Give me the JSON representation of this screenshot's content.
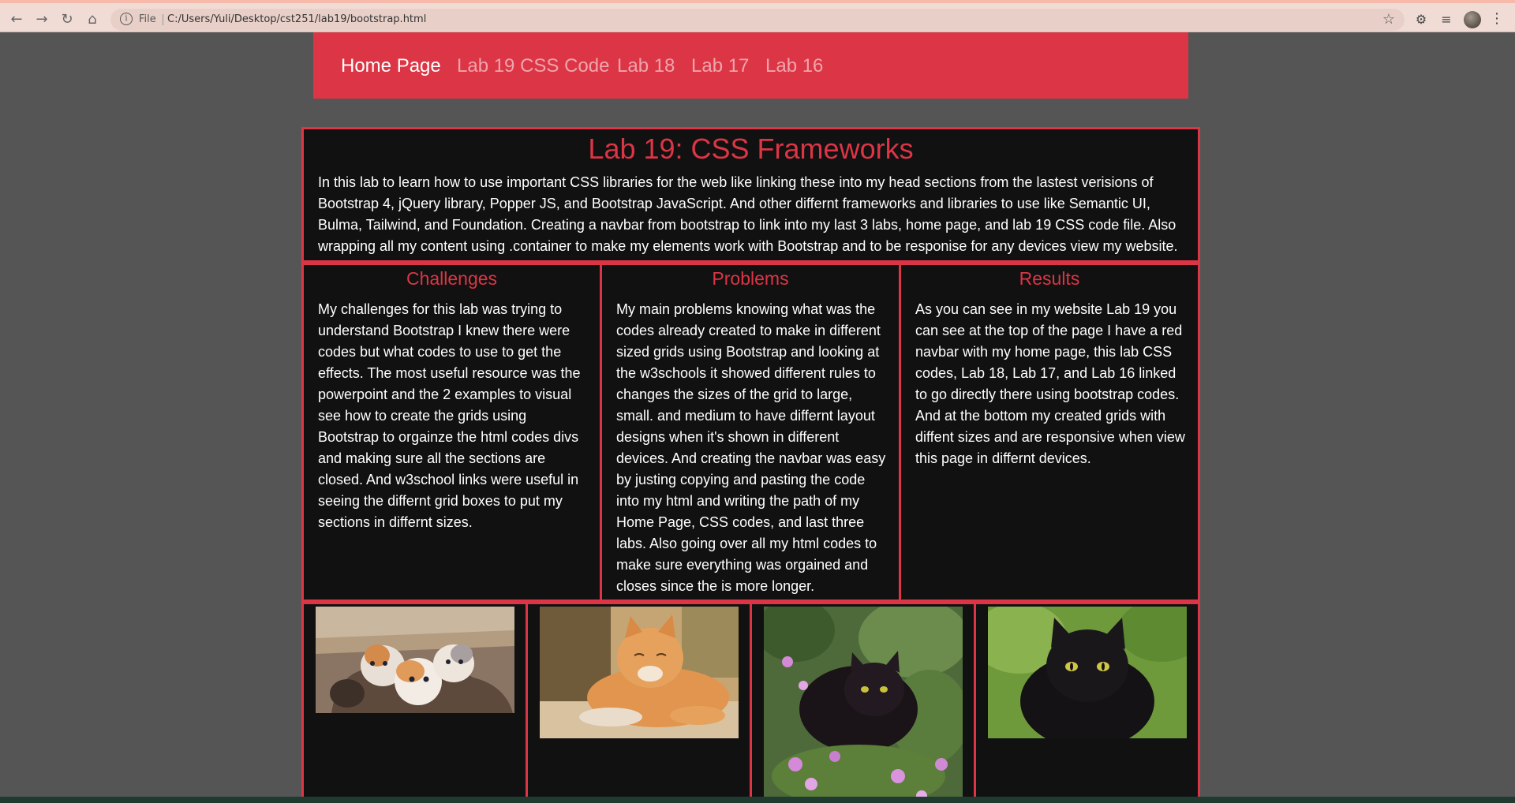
{
  "browser": {
    "file_label": "File",
    "url": "C:/Users/Yuli/Desktop/cst251/lab19/bootstrap.html"
  },
  "navbar": {
    "items": [
      "Home Page",
      "Lab 19 CSS Code",
      "Lab 18",
      "Lab 17",
      "Lab 16"
    ]
  },
  "intro": {
    "title": "Lab 19: CSS Frameworks",
    "text": "In this lab to learn how to use important CSS libraries for the web like linking these into my head sections from the lastest verisions of Bootstrap 4, jQuery library, Popper JS, and Bootstrap JavaScript. And other differnt frameworks and libraries to use like Semantic UI, Bulma, Tailwind, and Foundation. Creating a navbar from bootstrap to link into my last 3 labs, home page, and lab 19 CSS code file. Also wrapping all my content using .container to make my elements work with Bootstrap and to be responise for any devices view my website."
  },
  "columns": [
    {
      "title": "Challenges",
      "text": "My challenges for this lab was trying to understand Bootstrap I knew there were codes but what codes to use to get the effects. The most useful resource was the powerpoint and the 2 examples to visual see how to create the grids using Bootstrap to orgainze the html codes divs and making sure all the sections are closed. And w3school links were useful in seeing the differnt grid boxes to put my sections in differnt sizes."
    },
    {
      "title": "Problems",
      "text": "My main problems knowing what was the codes already created to make in different sized grids using Bootstrap and looking at the w3schools it showed different rules to changes the sizes of the grid to large, small. and medium to have differnt layout designs when it's shown in different devices. And creating the navbar was easy by justing copying and pasting the code into my html and writing the path of my Home Page, CSS codes, and last three labs. Also going over all my html codes to make sure everything was orgained and closes since the is more longer."
    },
    {
      "title": "Results",
      "text": "As you can see in my website Lab 19 you can see at the top of the page I have a red navbar with my home page, this lab CSS codes, Lab 18, Lab 17, and Lab 16 linked to go directly there using bootstrap codes. And at the bottom my created grids with diffent sizes and are responsive when view this page in differnt devices."
    }
  ],
  "images": [
    {
      "subject": "kittens-in-basket"
    },
    {
      "subject": "orange-cat-lying"
    },
    {
      "subject": "black-cat-in-flowers"
    },
    {
      "subject": "black-cat-on-grass"
    }
  ],
  "colors": {
    "accent": "#dc3545",
    "panel": "#111111",
    "page_bg": "#555555"
  }
}
